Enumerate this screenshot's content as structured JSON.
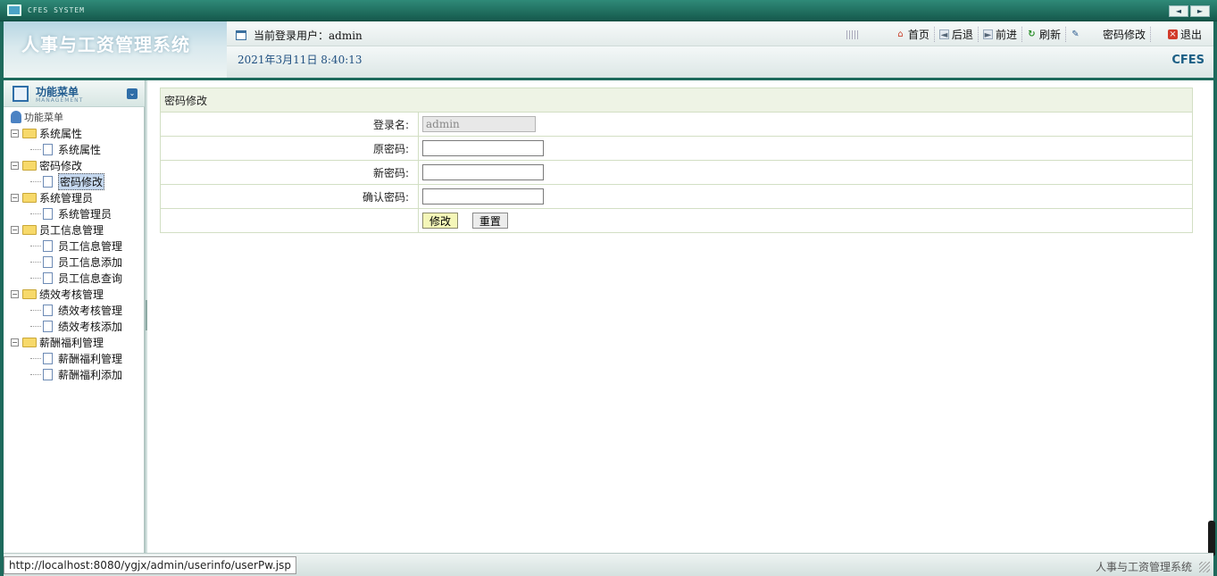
{
  "system_bar": {
    "title": "CFES SYSTEM",
    "prev_icon": "◄",
    "next_icon": "►"
  },
  "header": {
    "brand_title": "人事与工资管理系统",
    "current_user_label": "当前登录用户：admin",
    "datetime": "2021年3月11日 8:40:13",
    "logo_text": "CFES",
    "nav": [
      {
        "label": "首页",
        "icon": "home-icon",
        "glyph": "⌂"
      },
      {
        "label": "后退",
        "icon": "back-icon",
        "glyph": "◄"
      },
      {
        "label": "前进",
        "icon": "forward-icon",
        "glyph": "►"
      },
      {
        "label": "刷新",
        "icon": "refresh-icon",
        "glyph": "↻"
      },
      {
        "label": "密码修改",
        "icon": "password-icon",
        "glyph": "✎"
      },
      {
        "label": "退出",
        "icon": "exit-icon",
        "glyph": "×"
      }
    ]
  },
  "menu": {
    "title": "功能菜单",
    "subtitle": "MANAGEMENT",
    "toggle_glyph": "⌄",
    "root_label": "功能菜单",
    "groups": [
      {
        "label": "系统属性",
        "items": [
          "系统属性"
        ]
      },
      {
        "label": "密码修改",
        "items": [
          "密码修改"
        ]
      },
      {
        "label": "系统管理员",
        "items": [
          "系统管理员"
        ]
      },
      {
        "label": "员工信息管理",
        "items": [
          "员工信息管理",
          "员工信息添加",
          "员工信息查询"
        ]
      },
      {
        "label": "绩效考核管理",
        "items": [
          "绩效考核管理",
          "绩效考核添加"
        ]
      },
      {
        "label": "薪酬福利管理",
        "items": [
          "薪酬福利管理",
          "薪酬福利添加"
        ]
      }
    ],
    "selected": "密码修改"
  },
  "form": {
    "caption": "密码修改",
    "login_name_label": "登录名:",
    "login_name_value": "admin",
    "old_password_label": "原密码:",
    "new_password_label": "新密码:",
    "confirm_password_label": "确认密码:",
    "submit_label": "修改",
    "reset_label": "重置"
  },
  "status_bar": {
    "url": "http://localhost:8080/ygjx/admin/userinfo/userPw.jsp",
    "right_text": "人事与工资管理系统"
  },
  "colors": {
    "frame": "#1e6a5c",
    "accent": "#1f5a8e",
    "caption_bg": "#eef3e5",
    "button_primary": "#f4f6b8"
  }
}
